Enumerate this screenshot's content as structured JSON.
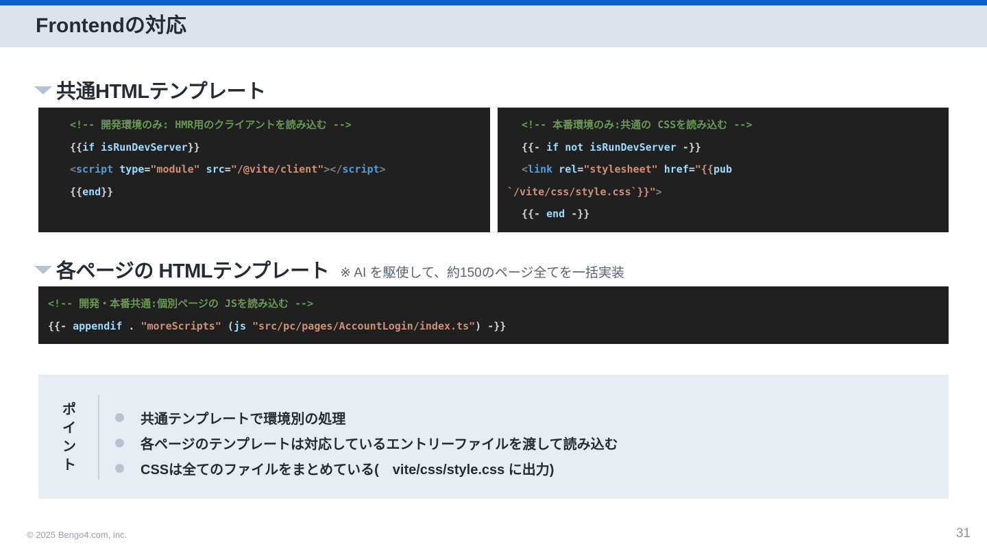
{
  "slide": {
    "title": "Frontendの対応",
    "page_number": "31",
    "copyright": "© 2025 Bengo4.com, inc."
  },
  "section1": {
    "title": "共通HTMLテンプレート",
    "left_code": {
      "l1": "<!-- 開発環境のみ: HMR用のクライアントを読み込む -->",
      "l2_open": "{{",
      "l2_if": "if",
      "l2_var": " isRunDevServer",
      "l2_close": "}}",
      "l3_lt": "<",
      "l3_tag": "script",
      "l3_attr1": " type",
      "l3_eq1": "=",
      "l3_val1": "\"module\"",
      "l3_attr2": " src",
      "l3_eq2": "=",
      "l3_val2": "\"/@vite/client\"",
      "l3_mid": "></",
      "l3_tag2": "script",
      "l3_gt": ">",
      "l4_open": "{{",
      "l4_end": "end",
      "l4_close": "}}"
    },
    "right_code": {
      "l1": "<!-- 本番環境のみ:共通の CSSを読み込む -->",
      "l2_open": "{{- ",
      "l2_kw": "if not isRunDevServer",
      "l2_close": " -}}",
      "l3_lt": "<",
      "l3_tag": "link",
      "l3_attr1": " rel",
      "l3_eq1": "=",
      "l3_val1": "\"stylesheet\"",
      "l3_attr2": " href",
      "l3_eq2": "=",
      "l3_val2": "\"{{",
      "l3_pub": "pub",
      "l4_val": "`/vite/css/style.css`}}\"",
      "l4_gt": ">",
      "l5_open": "{{- ",
      "l5_end": "end",
      "l5_close": " -}}"
    }
  },
  "section2": {
    "title": "各ページの HTMLテンプレート",
    "note": "※ AI を駆使して、約150のページ全てを一括実装",
    "code": {
      "l1": "<!-- 開発・本番共通:個別ページの JSを読み込む -->",
      "l2_open": "{{- ",
      "l2_fn": "appendif",
      "l2_dot": " . ",
      "l2_str1": "\"moreScripts\"",
      "l2_paren": " (",
      "l2_js": "js",
      "l2_sp": " ",
      "l2_str2": "\"src/pc/pages/AccountLogin/index.ts\"",
      "l2_close": ") -}}"
    }
  },
  "points": {
    "label_chars": [
      "ポ",
      "イ",
      "ン",
      "ト"
    ],
    "items": [
      "共通テンプレートで環境別の処理",
      "各ページのテンプレートは対応しているエントリーファイルを渡して読み込む",
      "CSSは全てのファイルをまとめている(　vite/css/style.css に出力)"
    ]
  },
  "colors": {
    "accent_bar": "#0a62c9",
    "title_band": "#dbe2ec",
    "code_bg": "#202020",
    "comment": "#6a9955",
    "string": "#ce9178",
    "keyword": "#9cdcfe",
    "tag": "#569cd6",
    "point_bg": "#e8edf4"
  }
}
